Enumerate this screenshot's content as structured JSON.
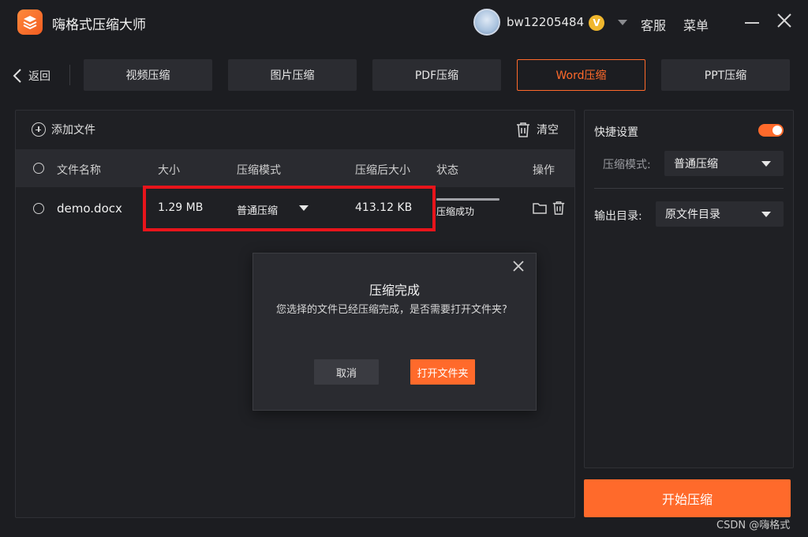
{
  "app": {
    "title": "嗨格式压缩大师"
  },
  "user": {
    "name": "bw12205484",
    "vip_badge": "V"
  },
  "topbar": {
    "service": "客服",
    "menu": "菜单"
  },
  "nav": {
    "back": "返回",
    "tabs": [
      {
        "label": "视频压缩",
        "active": false
      },
      {
        "label": "图片压缩",
        "active": false
      },
      {
        "label": "PDF压缩",
        "active": false
      },
      {
        "label": "Word压缩",
        "active": true
      },
      {
        "label": "PPT压缩",
        "active": false
      }
    ]
  },
  "toolbar": {
    "add_file": "添加文件",
    "clear": "清空"
  },
  "table": {
    "headers": {
      "name": "文件名称",
      "size": "大小",
      "mode": "压缩模式",
      "compressed_size": "压缩后大小",
      "status": "状态",
      "actions": "操作"
    },
    "rows": [
      {
        "name": "demo.docx",
        "size": "1.29 MB",
        "mode": "普通压缩",
        "compressed_size": "413.12 KB",
        "status": "压缩成功",
        "progress": 1.0
      }
    ]
  },
  "settings": {
    "quick_label": "快捷设置",
    "quick_enabled": true,
    "mode_label": "压缩模式:",
    "mode_value": "普通压缩",
    "output_label": "输出目录:",
    "output_value": "原文件目录",
    "start_button": "开始压缩"
  },
  "dialog": {
    "title": "压缩完成",
    "message": "您选择的文件已经压缩完成，是否需要打开文件夹?",
    "cancel": "取消",
    "confirm": "打开文件夹"
  },
  "watermark": "CSDN @嗨格式",
  "colors": {
    "accent": "#ff6a2b",
    "highlight": "#e8141b",
    "background": "#1c1d21"
  }
}
